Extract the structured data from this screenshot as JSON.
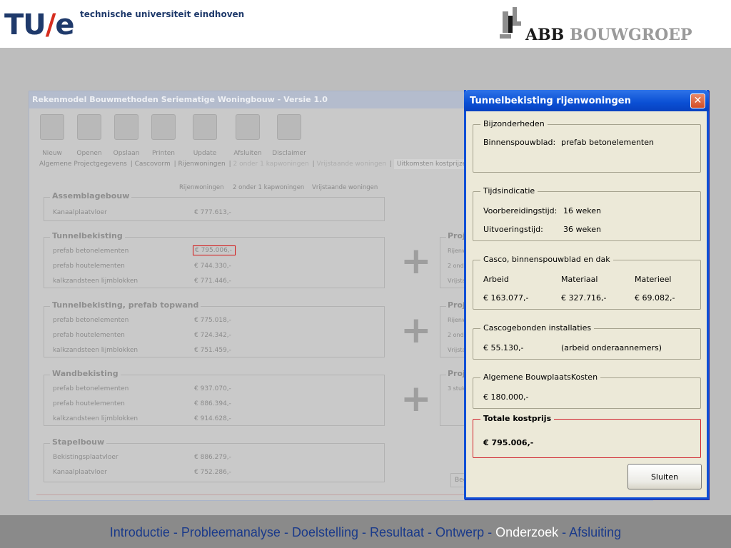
{
  "header": {
    "tue_logo": "TU/e",
    "tue_logo_tu": "TU",
    "tue_logo_slash": "/",
    "tue_logo_e": "e",
    "tue_tagline": "technische universiteit eindhoven",
    "abb_name_a": "ABB",
    "abb_name_b": "BOUWGROEP"
  },
  "footer": {
    "items": [
      "Introductie",
      "Probleemanalyse",
      "Doelstelling",
      "Resultaat",
      "Ontwerp",
      "Onderzoek",
      "Afsluiting"
    ],
    "separator": " - ",
    "current": "Onderzoek"
  },
  "app": {
    "title": "Rekenmodel Bouwmethoden Seriematige Woningbouw  -  Versie 1.0",
    "toolbar": [
      {
        "label": "Nieuw",
        "icon": "new-doc-icon"
      },
      {
        "label": "Openen",
        "icon": "open-icon"
      },
      {
        "label": "Opslaan",
        "icon": "save-icon"
      },
      {
        "label": "Printen",
        "icon": "print-icon"
      },
      {
        "label": "Update",
        "icon": "update-icon"
      },
      {
        "label": "Afsluiten",
        "icon": "exit-icon"
      },
      {
        "label": "Disclaimer",
        "icon": "disclaimer-icon"
      }
    ],
    "tabs": [
      "Algemene Projectgegevens",
      "Cascovorm",
      "Rijenwoningen",
      "2 onder 1 kapwoningen",
      "Vrijstaande woningen",
      "Uitkomsten kostprijzen"
    ],
    "columns": [
      "Rijenwoningen",
      "2 onder 1 kapwoningen",
      "Vrijstaande woningen"
    ],
    "groups": [
      {
        "title": "Assemblagebouw",
        "rows": [
          {
            "label": "Kanaalplaatvloer",
            "value": "€ 777.613,-"
          }
        ]
      },
      {
        "title": "Tunnelbekisting",
        "rows": [
          {
            "label": "prefab betonelementen",
            "value": "€ 795.006,-"
          },
          {
            "label": "prefab houtelementen",
            "value": "€ 744.330,-"
          },
          {
            "label": "kalkzandsteen lijmblokken",
            "value": "€ 771.446,-"
          }
        ]
      },
      {
        "title": "Tunnelbekisting, prefab topwand",
        "rows": [
          {
            "label": "prefab betonelementen",
            "value": "€ 775.018,-"
          },
          {
            "label": "prefab houtelementen",
            "value": "€ 724.342,-"
          },
          {
            "label": "kalkzandsteen lijmblokken",
            "value": "€ 751.459,-"
          }
        ]
      },
      {
        "title": "Wandbekisting",
        "rows": [
          {
            "label": "prefab betonelementen",
            "value": "€ 937.070,-"
          },
          {
            "label": "prefab houtelementen",
            "value": "€ 886.394,-"
          },
          {
            "label": "kalkzandsteen lijmblokken",
            "value": "€ 914.628,-"
          }
        ]
      },
      {
        "title": "Stapelbouw",
        "rows": [
          {
            "label": "Bekistingsplaatvloer",
            "value": "€ 886.279,-"
          },
          {
            "label": "Kanaalplaatvloer",
            "value": "€ 752.286,-"
          }
        ]
      }
    ],
    "plus": "+",
    "right_groups": [
      {
        "title": "Proj",
        "rows": [
          "Rijenw",
          "2 ond",
          "Vrijsta"
        ]
      },
      {
        "title": "Proj",
        "rows": [
          "Rijenw",
          "2 ond",
          "Vrijsta"
        ]
      },
      {
        "title": "Proj",
        "rows": [
          "3 stuk"
        ]
      }
    ],
    "beg_label": "Beg"
  },
  "dialog": {
    "title": "Tunnelbekisting rijenwoningen",
    "close_label": "✕",
    "bijzonderheden": {
      "legend": "Bijzonderheden",
      "label": "Binnenspouwblad:",
      "value": "prefab betonelementen"
    },
    "tijdsindicatie": {
      "legend": "Tijdsindicatie",
      "voorbereiding_label": "Voorbereidingstijd:",
      "voorbereiding_value": "16  weken",
      "uitvoering_label": "Uitvoeringstijd:",
      "uitvoering_value": "36  weken"
    },
    "casco": {
      "legend": "Casco, binnenspouwblad en dak",
      "headers": [
        "Arbeid",
        "Materiaal",
        "Materieel"
      ],
      "values": [
        "€ 163.077,-",
        "€ 327.716,-",
        "€ 69.082,-"
      ]
    },
    "installaties": {
      "legend": "Cascogebonden installaties",
      "value": "€ 55.130,-",
      "note": "(arbeid onderaannemers)"
    },
    "abk": {
      "legend": "Algemene BouwplaatsKosten",
      "value": "€ 180.000,-"
    },
    "totaal": {
      "legend": "Totale kostprijs",
      "value": "€ 795.006,-"
    },
    "close_button": "Sluiten"
  }
}
